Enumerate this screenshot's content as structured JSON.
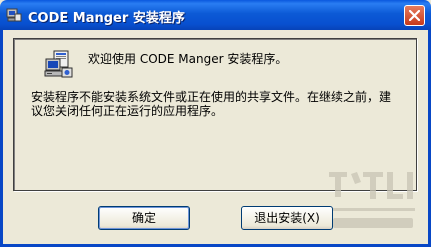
{
  "window": {
    "title": "CODE Manger 安装程序",
    "close_icon": "close-icon"
  },
  "content": {
    "welcome_text": "欢迎使用 CODE Manger 安装程序。",
    "warning_text": "安装程序不能安装系统文件或正在使用的共享文件。在继续之前，建议您关闭任何正在运行的应用程序。",
    "setup_icon": "setup-computer-icon"
  },
  "buttons": {
    "ok_label": "确定",
    "exit_label": "退出安装(X)"
  },
  "colors": {
    "titlebar": "#0a58de",
    "background": "#ece9d8",
    "close_button": "#c7391a"
  }
}
